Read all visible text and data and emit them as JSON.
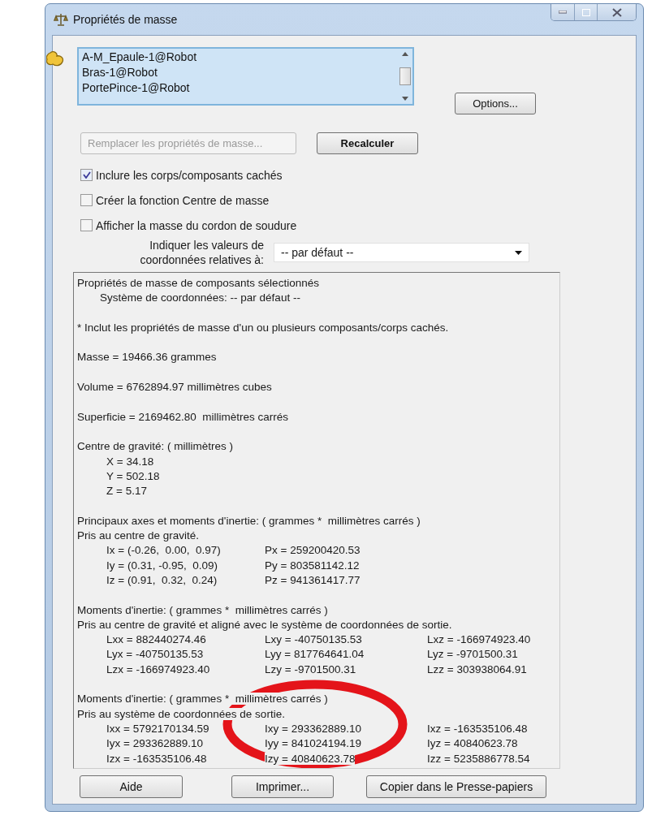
{
  "window": {
    "title": "Propriétés de masse"
  },
  "components": [
    {
      "label": "A-M_Epaule-1@Robot",
      "selected": true
    },
    {
      "label": "Bras-1@Robot",
      "selected": true
    },
    {
      "label": "PortePince-1@Robot",
      "selected": true
    }
  ],
  "options_button": {
    "label": "Options..."
  },
  "replace_button": {
    "label": "Remplacer les propriétés de masse...",
    "disabled": true
  },
  "recalc_button": {
    "label": "Recalculer",
    "disabled": false
  },
  "checkboxes": [
    {
      "label": "Inclure les corps/composants cachés",
      "checked": true
    },
    {
      "label": "Créer la fonction Centre de masse",
      "checked": false
    },
    {
      "label": "Afficher la masse du cordon de soudure",
      "checked": false
    }
  ],
  "coordinates": {
    "label_lines": [
      "Indiquer les valeurs de",
      "coordonnées relatives à:"
    ],
    "value": "-- par défaut --"
  },
  "results": [
    {
      "lines": [
        {
          "kind": "text",
          "text": "Propriétés de masse de composants sélectionnés"
        },
        {
          "kind": "indent",
          "text": "Système de coordonnées: -- par défaut --"
        }
      ]
    },
    {
      "lines": [
        {
          "kind": "text",
          "text": "* Inclut les propriétés de masse d'un ou plusieurs composants/corps cachés."
        }
      ]
    },
    {
      "lines": [
        {
          "kind": "text",
          "text": "Masse = 19466.36 grammes"
        }
      ]
    },
    {
      "lines": [
        {
          "kind": "text",
          "text": "Volume = 6762894.97 millimètres cubes"
        }
      ]
    },
    {
      "lines": [
        {
          "kind": "text",
          "text": "Superficie = 2169462.80  millimètres carrés"
        }
      ]
    },
    {
      "lines": [
        {
          "kind": "text",
          "text": "Centre de gravité: ( millimètres )"
        },
        {
          "kind": "row",
          "cells": [
            "X = 34.18"
          ]
        },
        {
          "kind": "row",
          "cells": [
            "Y = 502.18"
          ]
        },
        {
          "kind": "row",
          "cells": [
            "Z = 5.17"
          ]
        }
      ]
    },
    {
      "lines": [
        {
          "kind": "text",
          "text": "Principaux axes et moments d'inertie: ( grammes *  millimètres carrés )"
        },
        {
          "kind": "text",
          "text": "Pris au centre de gravité."
        },
        {
          "kind": "row",
          "cells": [
            "Ix = (-0.26,  0.00,  0.97)",
            "Px = 259200420.53"
          ]
        },
        {
          "kind": "row",
          "cells": [
            "Iy = (0.31, -0.95,  0.09)",
            "Py = 803581142.12"
          ]
        },
        {
          "kind": "row",
          "cells": [
            "Iz = (0.91,  0.32,  0.24)",
            "Pz = 941361417.77"
          ]
        }
      ]
    },
    {
      "lines": [
        {
          "kind": "text",
          "text": "Moments d'inertie: ( grammes *  millimètres carrés )"
        },
        {
          "kind": "text",
          "text": "Pris au centre de gravité et aligné avec le système de coordonnées de sortie."
        },
        {
          "kind": "row",
          "cells": [
            "Lxx = 882440274.46",
            "Lxy = -40750135.53",
            "Lxz = -166974923.40"
          ]
        },
        {
          "kind": "row",
          "cells": [
            "Lyx = -40750135.53",
            "Lyy = 817764641.04",
            "Lyz = -9701500.31"
          ]
        },
        {
          "kind": "row",
          "cells": [
            "Lzx = -166974923.40",
            "Lzy = -9701500.31",
            "Lzz = 303938064.91"
          ]
        }
      ]
    },
    {
      "lines": [
        {
          "kind": "text",
          "text": "Moments d'inertie: ( grammes *  millimètres carrés )"
        },
        {
          "kind": "text",
          "text": "Pris au système de coordonnées de sortie."
        },
        {
          "kind": "row",
          "cells": [
            "Ixx = 5792170134.59",
            "Ixy = 293362889.10",
            "Ixz = -163535106.48"
          ]
        },
        {
          "kind": "row",
          "cells": [
            "Iyx = 293362889.10",
            "Iyy = 841024194.19",
            "Iyz = 40840623.78"
          ]
        },
        {
          "kind": "row",
          "cells": [
            "Izx = -163535106.48",
            "Izy = 40840623.78",
            "Izz = 5235886778.54"
          ]
        }
      ]
    }
  ],
  "footer_buttons": [
    {
      "label": "Aide"
    },
    {
      "label": "Imprimer..."
    },
    {
      "label": "Copier dans le Presse-papiers"
    }
  ]
}
